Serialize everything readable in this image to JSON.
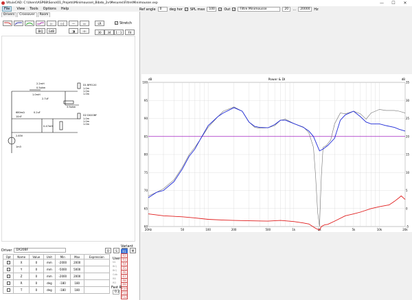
{
  "app": {
    "title": "VituixCAD: C:\\Users\\ASP68\\Sono\\01_Projets\\Minimousse\\_Bibdo_2v\\Mesures\\Filtre\\Minimousse.vxp"
  },
  "menu": [
    "File",
    "View",
    "Tools",
    "Options",
    "Help"
  ],
  "tabs": [
    "Drivers",
    "Crossover",
    "Room"
  ],
  "toolbar": {
    "zoom": "30",
    "zoom2": "34",
    "pages": "1 : 1",
    "fit": "Fit",
    "stretch_label": "Stretch",
    "biq": "BiQ",
    "gain": "GdB",
    "lr": "LR"
  },
  "right_toolbar": {
    "ref_angle_label": "Ref angle",
    "ref_angle": "0",
    "deg_hor": "deg hor",
    "spl_max_label": "SPL max",
    "spl_max": "100",
    "out_label": "Out",
    "filter_name": "Filtre Minimousse",
    "f_min": "20",
    "dash": "...",
    "f_max": "20000",
    "hz": "Hz"
  },
  "schematic": {
    "labels": [
      "2.2mH",
      "0.5ohm",
      "1.0mH",
      "2.7uF",
      "D1 BPE120",
      "1.0m",
      "1.0m",
      "1.0m",
      "3.9ohm",
      "680mΩ",
      "10nF",
      "0.2uF",
      "0.47mH",
      "D2 DX20BF",
      "1.0m",
      "1.0m",
      "1.0m",
      "2.83V",
      "1m3"
    ]
  },
  "driver": {
    "label": "Driver",
    "selected": "DX20BF",
    "btns": [
      "O",
      "S",
      "i",
      "M"
    ]
  },
  "ptable": {
    "headers": [
      "Opt",
      "Name",
      "Value",
      "Unit",
      "Min",
      "Max",
      "Expression"
    ],
    "rows": [
      [
        "X",
        "0",
        "mm",
        "-2000",
        "2000",
        ""
      ],
      [
        "Y",
        "0",
        "mm",
        "-5000",
        "5000",
        ""
      ],
      [
        "Z",
        "0",
        "mm",
        "-2000",
        "2000",
        ""
      ],
      [
        "R",
        "0",
        "deg",
        "-180",
        "180",
        ""
      ],
      [
        "T",
        "0",
        "deg",
        "-180",
        "180",
        ""
      ]
    ]
  },
  "variant": {
    "label": "Variant",
    "items": [
      "R1",
      "R2",
      "R3",
      "R4",
      "R5",
      "R6",
      "R7",
      "R8",
      "R9",
      "R10",
      "R11",
      "R12"
    ],
    "fast_label": "Fast R",
    "fast": "0.2",
    "user_label": "User",
    "user": [
      "N1",
      "BiQ",
      "BiQ",
      "Gdb",
      "RB",
      "RD"
    ]
  },
  "chart_data": {
    "type": "line",
    "title": "Power & DI",
    "left_unit": "dB",
    "right_unit": "dB",
    "y_left_ticks": [
      100,
      95,
      90,
      85,
      80,
      75,
      70,
      65,
      60
    ],
    "y_right_ticks": [
      35,
      30,
      25,
      20,
      15,
      10,
      5,
      0,
      -5
    ],
    "x_ticks": [
      "20Hz",
      "50",
      "100",
      "200",
      "500",
      "1k",
      "2k",
      "5k",
      "10k",
      "20k"
    ],
    "xlim": [
      20,
      20000
    ],
    "ylim": [
      60,
      100
    ],
    "y2lim": [
      -5,
      35
    ],
    "colors": {
      "power": "#1f2bd8",
      "power_ref": "#707070",
      "di": "#e01a1a",
      "ref_line": "#a020c0",
      "grid": "#d8d8d8"
    },
    "ref_level": 85,
    "series": [
      {
        "id": "power_ref",
        "x": [
          20,
          25,
          30,
          40,
          50,
          60,
          70,
          80,
          100,
          130,
          150,
          200,
          250,
          300,
          350,
          400,
          500,
          600,
          700,
          800,
          1000,
          1300,
          1500,
          1700,
          1800,
          1900,
          2000,
          2100,
          2200,
          2400,
          2700,
          3000,
          3500,
          4000,
          5000,
          6000,
          7000,
          8000,
          10000,
          12000,
          15000,
          17000,
          20000
        ],
        "y": [
          68.5,
          69.5,
          70.5,
          73,
          76.5,
          80,
          82,
          84,
          87.5,
          90.5,
          92,
          93.2,
          92,
          89,
          87.5,
          87.3,
          87.4,
          88,
          89.5,
          89.8,
          88.6,
          87.6,
          86,
          82,
          74,
          64,
          60,
          74,
          82,
          82.5,
          84,
          88.5,
          91.5,
          91.3,
          92,
          91.3,
          89.8,
          91.5,
          92.5,
          92.2,
          92.2,
          92,
          91.5
        ]
      },
      {
        "id": "power",
        "x": [
          20,
          25,
          30,
          40,
          50,
          60,
          70,
          80,
          100,
          130,
          150,
          200,
          250,
          300,
          350,
          400,
          500,
          600,
          700,
          800,
          1000,
          1300,
          1500,
          1700,
          2000,
          2200,
          2500,
          3000,
          3500,
          4000,
          5000,
          6000,
          7000,
          8000,
          10000,
          12000,
          15000,
          17000,
          20000
        ],
        "y": [
          68,
          69.5,
          70,
          72.5,
          76,
          79.5,
          81.5,
          84,
          88,
          90.5,
          91.5,
          93,
          92,
          89,
          87.8,
          87.5,
          87.4,
          88.3,
          89.5,
          89.5,
          88.6,
          87.5,
          86.5,
          85,
          81,
          81.5,
          82.5,
          84.5,
          89.5,
          91,
          92,
          90.5,
          89,
          88.5,
          88.5,
          88,
          87.5,
          87,
          86.5
        ]
      },
      {
        "id": "di",
        "x": [
          20,
          30,
          50,
          70,
          100,
          150,
          200,
          300,
          500,
          700,
          1000,
          1300,
          1500,
          1800,
          2000,
          2100,
          2300,
          2500,
          3000,
          4000,
          5000,
          6000,
          8000,
          10000,
          13000,
          15000,
          17000,
          18000,
          20000
        ],
        "y": [
          -1.5,
          -2,
          -2.3,
          -2.6,
          -3,
          -3.2,
          -3.3,
          -3.4,
          -3.5,
          -3.3,
          -3.6,
          -4,
          -4.3,
          -5.5,
          -6,
          -5,
          -4.5,
          -4.4,
          -3.5,
          -2,
          -1.5,
          -1,
          0,
          0.5,
          1,
          2,
          3,
          3.5,
          2.5
        ]
      }
    ]
  }
}
